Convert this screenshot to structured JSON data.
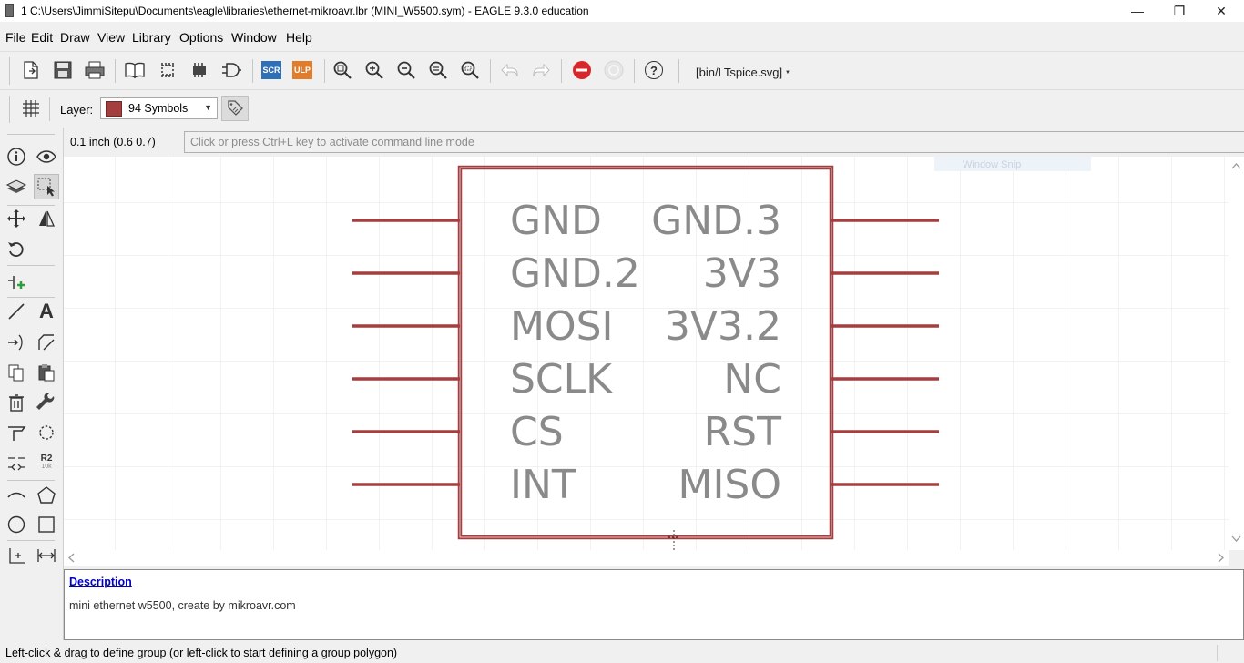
{
  "window": {
    "title": "1 C:\\Users\\JimmiSitepu\\Documents\\eagle\\libraries\\ethernet-mikroavr.lbr (MINI_W5500.sym) - EAGLE 9.3.0 education",
    "minimize_glyph": "—",
    "restore_glyph": "❐",
    "close_glyph": "✕"
  },
  "menu": [
    "File",
    "Edit",
    "Draw",
    "View",
    "Library",
    "Options",
    "Window",
    "Help"
  ],
  "toolbar": {
    "scr_label": "SCR",
    "ulp_label": "ULP",
    "help_glyph": "?",
    "ulp_path": "[bin/LTspice.svg]",
    "icons": [
      "new-file-icon",
      "save-icon",
      "print-icon",
      "library-book-icon",
      "package-icon",
      "device-icon",
      "symbol-icon",
      "scr-icon",
      "ulp-icon",
      "zoom-fit-icon",
      "zoom-in-icon",
      "zoom-out-icon",
      "zoom-redraw-icon",
      "zoom-select-icon",
      "undo-icon",
      "redo-icon",
      "stop-icon",
      "go-icon",
      "help-icon"
    ]
  },
  "layerbar": {
    "label": "Layer:",
    "selected_layer": "94 Symbols",
    "layer_color": "#a43f3f"
  },
  "commandbar": {
    "grid_readout": "0.1 inch (0.6 0.7)",
    "placeholder": "Click or press Ctrl+L key to activate command line mode"
  },
  "lefttools": {
    "name_value_label": "R2",
    "name_value_sub": "10k",
    "text_glyph": "A"
  },
  "symbol": {
    "outline_color": "#a43f3f",
    "label_color": "#8a8a8a",
    "left_pins": [
      "GND",
      "GND.2",
      "MOSI",
      "SCLK",
      "CS",
      "INT"
    ],
    "right_pins": [
      "GND.3",
      "3V3",
      "3V3.2",
      "NC",
      "RST",
      "MISO"
    ]
  },
  "ghost_tooltip": "Window Snip",
  "description": {
    "heading": "Description",
    "text": "mini ethernet w5500, create by mikroavr.com"
  },
  "status": {
    "text": "Left-click & drag to define group (or left-click to start defining a group polygon)"
  }
}
